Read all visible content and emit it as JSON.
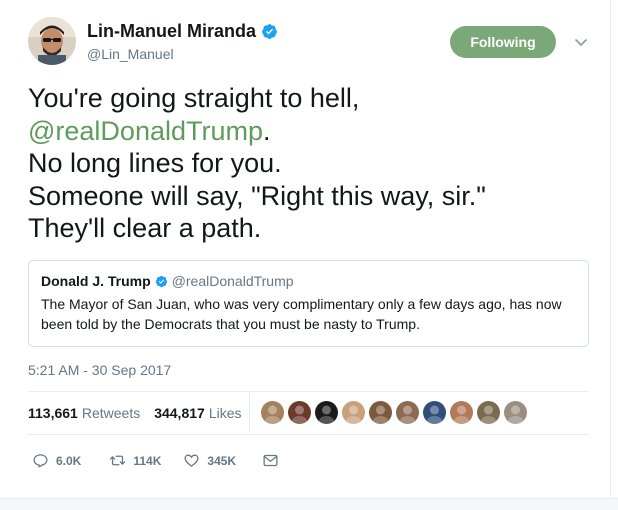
{
  "author": {
    "display_name": "Lin-Manuel Miranda",
    "handle": "@Lin_Manuel",
    "verified_icon": "verified-badge-icon"
  },
  "follow_button": {
    "label": "Following",
    "color": "#7aa977"
  },
  "tweet": {
    "lines": [
      "You're going straight to hell,",
      "@realDonaldTrump",
      ".",
      "No long lines for you.",
      "Someone will say, \"Right this way, sir.\"",
      "They'll clear a path."
    ],
    "mention_color": "#5e9c5b"
  },
  "quote": {
    "display_name": "Donald J. Trump",
    "handle": "@realDonaldTrump",
    "text": "The Mayor of San Juan, who was very complimentary only a few days ago, has now been told by the Democrats that you must be nasty to Trump."
  },
  "timestamp": "5:21 AM - 30 Sep 2017",
  "stats": {
    "retweets": {
      "count": "113,661",
      "label": "Retweets"
    },
    "likes": {
      "count": "344,817",
      "label": "Likes"
    }
  },
  "likers": [
    {
      "color": "#a4815f"
    },
    {
      "color": "#6b3a2a"
    },
    {
      "color": "#1b1b1b"
    },
    {
      "color": "#c9a07a"
    },
    {
      "color": "#7c5a3e"
    },
    {
      "color": "#8a6b52"
    },
    {
      "color": "#2f4f7a"
    },
    {
      "color": "#b07a5a"
    },
    {
      "color": "#7a6a4f"
    },
    {
      "color": "#9a8e80"
    }
  ],
  "actions": {
    "reply": {
      "count": "6.0K",
      "icon": "reply-icon"
    },
    "retweet": {
      "count": "114K",
      "icon": "retweet-icon"
    },
    "like": {
      "count": "345K",
      "icon": "heart-icon"
    },
    "message": {
      "icon": "direct-message-icon"
    }
  }
}
